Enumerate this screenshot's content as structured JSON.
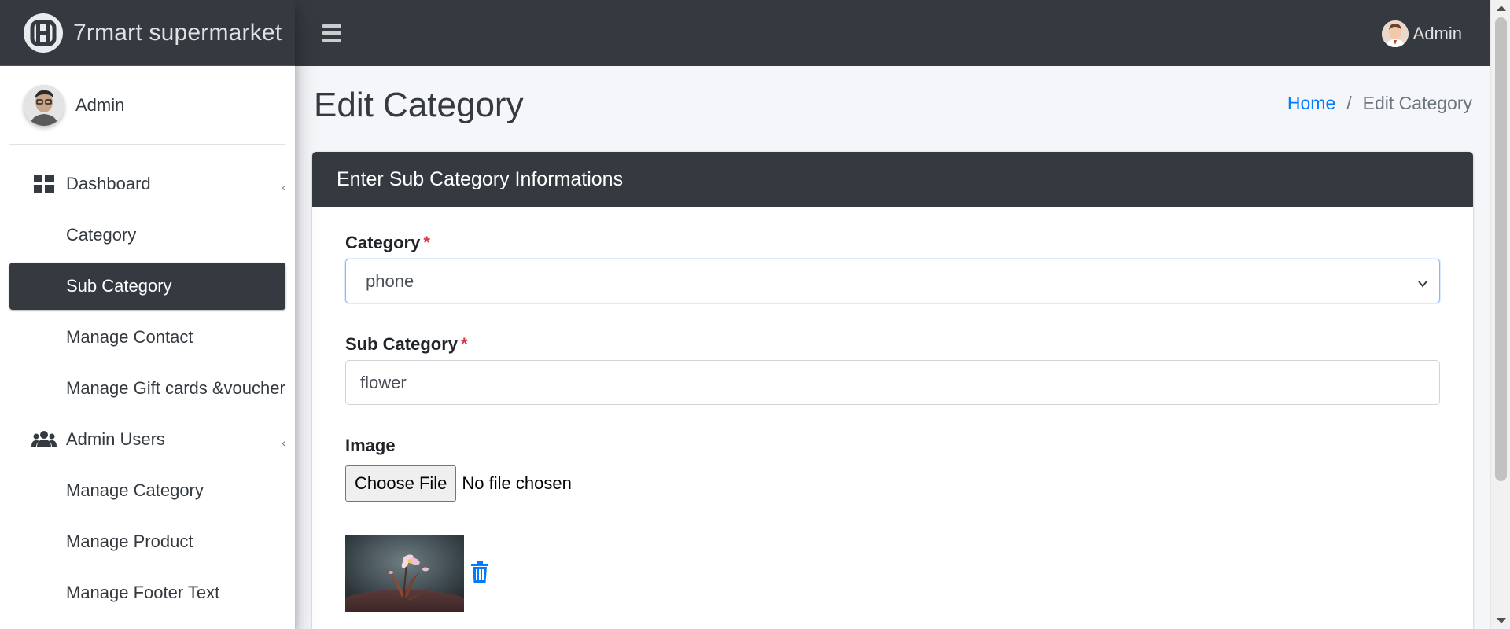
{
  "brand": {
    "name": "7rmart supermarket",
    "logo": "brand-logo-icon"
  },
  "sidebar": {
    "user_name": "Admin",
    "items": [
      {
        "label": "Dashboard",
        "icon": "dashboard-grid-icon",
        "has_arrow": true
      },
      {
        "label": "Category",
        "sub": true
      },
      {
        "label": "Sub Category",
        "sub": true,
        "active": true
      },
      {
        "label": "Manage Contact",
        "sub": true
      },
      {
        "label": "Manage Gift cards &voucher",
        "sub": true
      },
      {
        "label": "Admin Users",
        "icon": "users-icon",
        "has_arrow": true
      },
      {
        "label": "Manage Category",
        "sub": true
      },
      {
        "label": "Manage Product",
        "sub": true
      },
      {
        "label": "Manage Footer Text",
        "sub": true
      }
    ]
  },
  "topbar": {
    "menu_icon": "hamburger-icon",
    "user_name": "Admin"
  },
  "header": {
    "title": "Edit Category",
    "breadcrumb": {
      "home": "Home",
      "separator": "/",
      "current": "Edit Category"
    }
  },
  "card": {
    "title": "Enter Sub Category Informations",
    "category": {
      "label": "Category",
      "required_mark": "*",
      "selected": "phone"
    },
    "sub_category": {
      "label": "Sub Category",
      "required_mark": "*",
      "value": "flower"
    },
    "image": {
      "label": "Image",
      "button": "Choose File",
      "status": "No file chosen",
      "delete_icon": "trash-icon"
    }
  },
  "colors": {
    "dark": "#343a40",
    "link": "#007bff",
    "required": "#dc3545",
    "focus_border": "#80bdff"
  }
}
